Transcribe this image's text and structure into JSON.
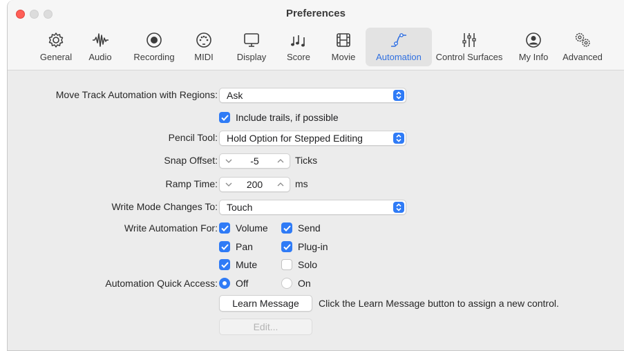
{
  "window": {
    "title": "Preferences"
  },
  "toolbar": {
    "tabs": [
      {
        "label": "General",
        "icon": "gear-icon"
      },
      {
        "label": "Audio",
        "icon": "waveform-icon"
      },
      {
        "label": "Recording",
        "icon": "record-icon"
      },
      {
        "label": "MIDI",
        "icon": "midi-port-icon"
      },
      {
        "label": "Display",
        "icon": "monitor-icon"
      },
      {
        "label": "Score",
        "icon": "music-notes-icon"
      },
      {
        "label": "Movie",
        "icon": "film-icon"
      },
      {
        "label": "Automation",
        "icon": "automation-curve-icon",
        "selected": true
      },
      {
        "label": "Control Surfaces",
        "icon": "sliders-icon"
      },
      {
        "label": "My Info",
        "icon": "person-circle-icon"
      },
      {
        "label": "Advanced",
        "icon": "gears-icon"
      }
    ]
  },
  "settings": {
    "move_track_automation": {
      "label": "Move Track Automation with Regions:",
      "value": "Ask"
    },
    "include_trails": {
      "label": "Include trails, if possible",
      "checked": true
    },
    "pencil_tool": {
      "label": "Pencil Tool:",
      "value": "Hold Option for Stepped Editing"
    },
    "snap_offset": {
      "label": "Snap Offset:",
      "value": "-5",
      "unit": "Ticks"
    },
    "ramp_time": {
      "label": "Ramp Time:",
      "value": "200",
      "unit": "ms"
    },
    "write_mode_changes": {
      "label": "Write Mode Changes To:",
      "value": "Touch"
    },
    "write_automation_for": {
      "label": "Write Automation For:",
      "volume": {
        "label": "Volume",
        "checked": true
      },
      "send": {
        "label": "Send",
        "checked": true
      },
      "pan": {
        "label": "Pan",
        "checked": true
      },
      "plugin": {
        "label": "Plug-in",
        "checked": true
      },
      "mute": {
        "label": "Mute",
        "checked": true
      },
      "solo": {
        "label": "Solo",
        "checked": false
      }
    },
    "automation_quick_access": {
      "label": "Automation Quick Access:",
      "off_label": "Off",
      "on_label": "On",
      "selected": "Off"
    },
    "learn_message_button": "Learn Message",
    "learn_hint": "Click the Learn Message button to assign a new control.",
    "edit_button": "Edit..."
  },
  "colors": {
    "accent": "#2f7bf6",
    "close": "#ff5f57",
    "selected_tab_text": "#2f6fe0"
  }
}
